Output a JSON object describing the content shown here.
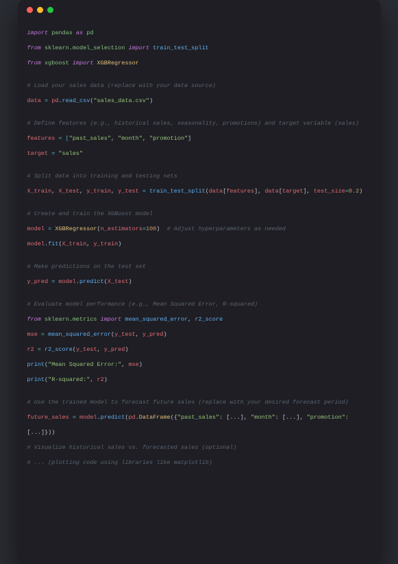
{
  "window": {
    "dots": {
      "red": "#ff5f57",
      "yellow": "#febc2e",
      "green": "#28c840"
    }
  },
  "code": {
    "l01a": "import",
    "l01b": " pandas ",
    "l01c": "as",
    "l01d": " pd",
    "l02a": "from",
    "l02b": " sklearn",
    "l02c": ".",
    "l02d": "model_selection ",
    "l02e": "import",
    "l02f": " train_test_split",
    "l03a": "from",
    "l03b": " xgboost ",
    "l03c": "import",
    "l03d": " XGBRegressor",
    "l04": "",
    "l05": "# Load your sales data (replace with your data source)",
    "l06a": "data",
    "l06b": " = ",
    "l06c": "pd",
    "l06d": ".",
    "l06e": "read_csv",
    "l06f": "(",
    "l06g": "\"sales_data.csv\"",
    "l06h": ")",
    "l07": "",
    "l08": "# Define features (e.g., historical sales, seasonality, promotions) and target variable (sales)",
    "l09a": "features",
    "l09b": " = [",
    "l09c": "\"past_sales\"",
    "l09d": ", ",
    "l09e": "\"month\"",
    "l09f": ", ",
    "l09g": "\"promotion\"",
    "l09h": "]",
    "l10a": "target",
    "l10b": " = ",
    "l10c": "\"sales\"",
    "l11": "",
    "l12": "# Split data into training and testing sets",
    "l13a": "X_train",
    "l13b": ", ",
    "l13c": "X_test",
    "l13d": ", ",
    "l13e": "y_train",
    "l13f": ", ",
    "l13g": "y_test",
    "l13h": " = ",
    "l13i": "train_test_split",
    "l13j": "(",
    "l13k": "data",
    "l13l": "[",
    "l13m": "features",
    "l13n": "], ",
    "l13o": "data",
    "l13p": "[",
    "l13q": "target",
    "l13r": "], ",
    "l13s": "test_size",
    "l13t": "=",
    "l13u": "0.2",
    "l13v": ")",
    "l14": "",
    "l15": "# Create and train the XGBoost model",
    "l16a": "model",
    "l16b": " = ",
    "l16c": "XGBRegressor",
    "l16d": "(",
    "l16e": "n_estimators",
    "l16f": "=",
    "l16g": "100",
    "l16h": ")  ",
    "l16i": "# Adjust hyperparameters as needed",
    "l17a": "model",
    "l17b": ".",
    "l17c": "fit",
    "l17d": "(",
    "l17e": "X_train",
    "l17f": ", ",
    "l17g": "y_train",
    "l17h": ")",
    "l18": "",
    "l19": "# Make predictions on the test set",
    "l20a": "y_pred",
    "l20b": " = ",
    "l20c": "model",
    "l20d": ".",
    "l20e": "predict",
    "l20f": "(",
    "l20g": "X_test",
    "l20h": ")",
    "l21": "",
    "l22": "# Evaluate model performance (e.g., Mean Squared Error, R-squared)",
    "l23a": "from",
    "l23b": " sklearn",
    "l23c": ".",
    "l23d": "metrics ",
    "l23e": "import",
    "l23f": " mean_squared_error",
    "l23g": ", ",
    "l23h": "r2_score",
    "l24a": "mse",
    "l24b": " = ",
    "l24c": "mean_squared_error",
    "l24d": "(",
    "l24e": "y_test",
    "l24f": ", ",
    "l24g": "y_pred",
    "l24h": ")",
    "l25a": "r2",
    "l25b": " = ",
    "l25c": "r2_score",
    "l25d": "(",
    "l25e": "y_test",
    "l25f": ", ",
    "l25g": "y_pred",
    "l25h": ")",
    "l26a": "print",
    "l26b": "(",
    "l26c": "\"Mean Squared Error:\"",
    "l26d": ", ",
    "l26e": "mse",
    "l26f": ")",
    "l27a": "print",
    "l27b": "(",
    "l27c": "\"R-squared:\"",
    "l27d": ", ",
    "l27e": "r2",
    "l27f": ")",
    "l28": "",
    "l29": "# Use the trained model to forecast future sales (replace with your desired forecast period)",
    "l30a": "future_sales",
    "l30b": " = ",
    "l30c": "model",
    "l30d": ".",
    "l30e": "predict",
    "l30f": "(",
    "l30g": "pd",
    "l30h": ".",
    "l30i": "DataFrame",
    "l30j": "({",
    "l30k": "\"past_sales\"",
    "l30l": ": [...], ",
    "l30m": "\"month\"",
    "l30n": ": [...], ",
    "l30o": "\"promotion\"",
    "l30p": ": ",
    "l31a": "[...]}))",
    "l32": "# Visualize historical sales vs. forecasted sales (optional)",
    "l33": "# ... (plotting code using libraries like matplotlib)"
  }
}
